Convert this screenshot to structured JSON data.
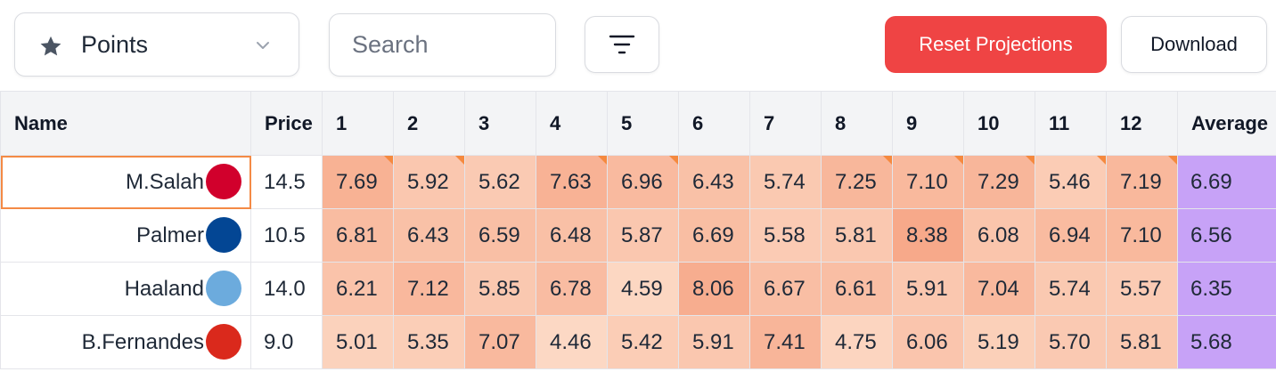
{
  "toolbar": {
    "view_select": {
      "selected": "Points",
      "icon": "star-icon"
    },
    "search": {
      "placeholder": "Search",
      "value": ""
    },
    "filter_icon": "filter-lines-icon",
    "reset_label": "Reset Projections",
    "download_label": "Download"
  },
  "colors": {
    "reset_bg": "#ef4444",
    "average_bg": "#c7a2f7",
    "heat_low": "#fcd9c5",
    "heat_high": "#f7a98a",
    "corner_marker": "#f5893f",
    "selection_outline": "#f48a45"
  },
  "table": {
    "headers": {
      "name": "Name",
      "price": "Price",
      "gameweeks": [
        "1",
        "2",
        "3",
        "4",
        "5",
        "6",
        "7",
        "8",
        "9",
        "10",
        "11",
        "12"
      ],
      "average": "Average"
    },
    "rows": [
      {
        "name": "M.Salah",
        "badge_color": "#d1002c",
        "price": "14.5",
        "selected": true,
        "values": [
          "7.69",
          "5.92",
          "5.62",
          "7.63",
          "6.96",
          "6.43",
          "5.74",
          "7.25",
          "7.10",
          "7.29",
          "5.46",
          "7.19"
        ],
        "flagged": [
          true,
          true,
          false,
          true,
          true,
          false,
          false,
          true,
          true,
          true,
          true,
          true
        ],
        "average": "6.69"
      },
      {
        "name": "Palmer",
        "badge_color": "#034694",
        "price": "10.5",
        "selected": false,
        "values": [
          "6.81",
          "6.43",
          "6.59",
          "6.48",
          "5.87",
          "6.69",
          "5.58",
          "5.81",
          "8.38",
          "6.08",
          "6.94",
          "7.10"
        ],
        "flagged": [
          false,
          false,
          false,
          false,
          false,
          false,
          false,
          false,
          false,
          false,
          false,
          false
        ],
        "average": "6.56"
      },
      {
        "name": "Haaland",
        "badge_color": "#6cabdd",
        "price": "14.0",
        "selected": false,
        "values": [
          "6.21",
          "7.12",
          "5.85",
          "6.78",
          "4.59",
          "8.06",
          "6.67",
          "6.61",
          "5.91",
          "7.04",
          "5.74",
          "5.57"
        ],
        "flagged": [
          false,
          false,
          false,
          false,
          false,
          false,
          false,
          false,
          false,
          false,
          false,
          false
        ],
        "average": "6.35"
      },
      {
        "name": "B.Fernandes",
        "badge_color": "#da291c",
        "price": "9.0",
        "selected": false,
        "values": [
          "5.01",
          "5.35",
          "7.07",
          "4.46",
          "5.42",
          "5.91",
          "7.41",
          "4.75",
          "6.06",
          "5.19",
          "5.70",
          "5.81"
        ],
        "flagged": [
          false,
          false,
          false,
          false,
          false,
          false,
          false,
          false,
          false,
          false,
          false,
          false
        ],
        "average": "5.68"
      }
    ]
  }
}
